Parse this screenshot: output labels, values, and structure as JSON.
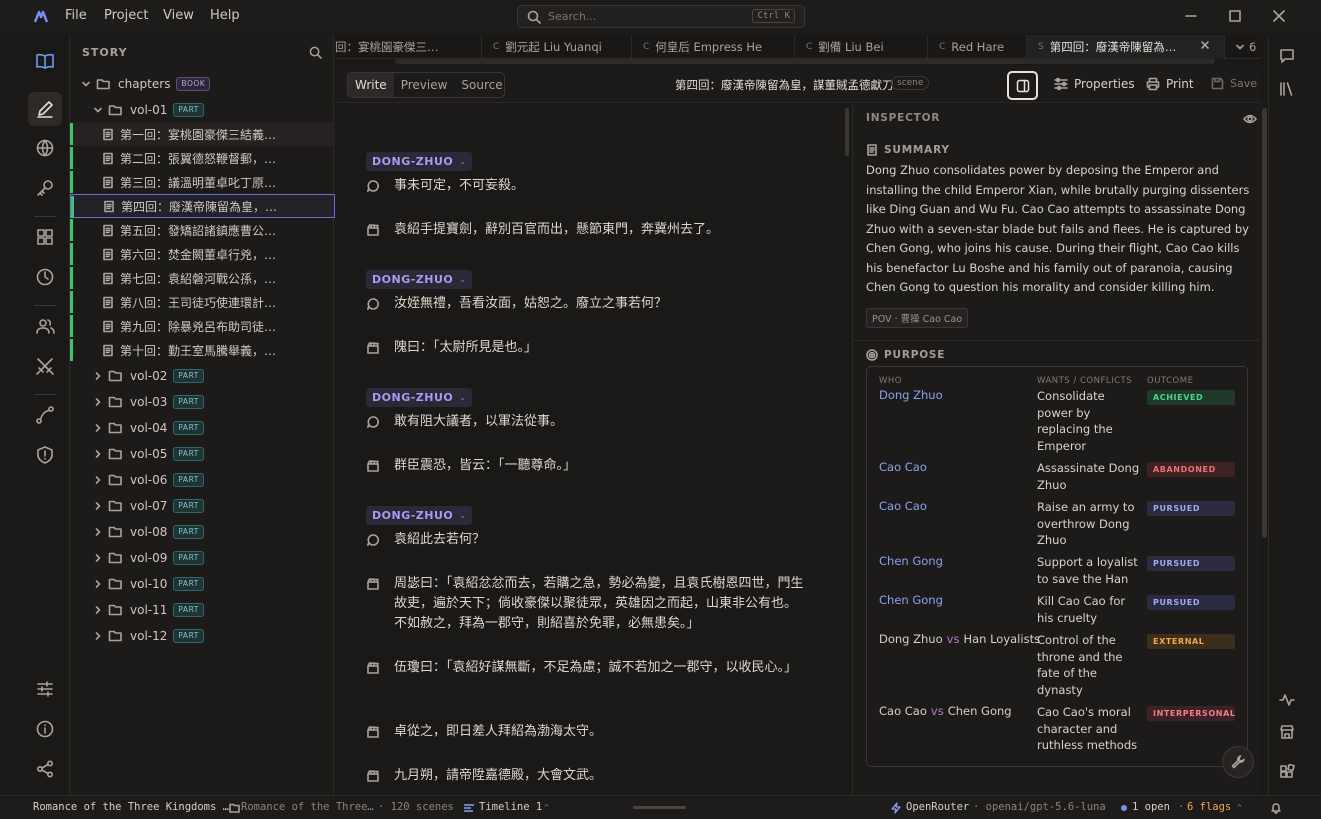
{
  "menu": [
    "File",
    "Project",
    "View",
    "Help"
  ],
  "search": {
    "placeholder": "Search...",
    "shortcut": "Ctrl K"
  },
  "sidebar": {
    "title": "STORY",
    "root": {
      "label": "chapters",
      "badge": "BOOK"
    },
    "vol01": {
      "label": "vol-01",
      "badge": "PART"
    },
    "chapters": [
      "第一回：宴桃園豪傑三結義…",
      "第二回：張翼德怒鞭督郵，…",
      "第三回：議溫明董卓叱丁原…",
      "第四回：廢漢帝陳留為皇，…",
      "第五回：發矯詔諸鎮應曹公…",
      "第六回：焚金闕董卓行兇，…",
      "第七回：袁紹磐河戰公孫，…",
      "第八回：王司徒巧使連環計…",
      "第九回：除暴兇呂布助司徒…",
      "第十回：勤王室馬騰舉義，…"
    ],
    "volumes": [
      "vol-02",
      "vol-03",
      "vol-04",
      "vol-05",
      "vol-06",
      "vol-07",
      "vol-08",
      "vol-09",
      "vol-10",
      "vol-11",
      "vol-12"
    ],
    "part_badge": "PART"
  },
  "tabs": [
    {
      "kind": "",
      "label": "回：宴桃園豪傑三…"
    },
    {
      "kind": "C",
      "label": "劉元起 Liu Yuanqi"
    },
    {
      "kind": "C",
      "label": "何皇后 Empress He"
    },
    {
      "kind": "C",
      "label": "劉備 Liu Bei"
    },
    {
      "kind": "C",
      "label": "Red Hare"
    },
    {
      "kind": "S",
      "label": "第四回：廢漢帝陳留為…"
    }
  ],
  "tab_overflow": "6",
  "toolbar": {
    "modes": [
      "Write",
      "Preview",
      "Source"
    ],
    "doc_title": "第四回：廢漢帝陳留為皇，謀董賊孟德獻刀",
    "doc_kind": "scene",
    "properties": "Properties",
    "print": "Print",
    "save": "Save"
  },
  "editor": {
    "blocks": [
      {
        "type": "speaker",
        "text": "DONG-ZHUO"
      },
      {
        "type": "dialogue",
        "text": "事未可定，不可妄殺。"
      },
      {
        "type": "action",
        "text": "袁紹手提寶劍，辭別百官而出，懸節東門，奔冀州去了。"
      },
      {
        "type": "speaker",
        "text": "DONG-ZHUO"
      },
      {
        "type": "dialogue",
        "text": "汝姪無禮，吾看汝面，姑恕之。廢立之事若何？"
      },
      {
        "type": "action",
        "text": "隗曰：「太尉所見是也。」"
      },
      {
        "type": "speaker",
        "text": "DONG-ZHUO"
      },
      {
        "type": "dialogue",
        "text": "敢有阻大議者，以軍法從事。"
      },
      {
        "type": "action",
        "text": "群臣震恐，皆云：「一聽尊命。」"
      },
      {
        "type": "speaker",
        "text": "DONG-ZHUO"
      },
      {
        "type": "dialogue",
        "text": "袁紹此去若何？"
      },
      {
        "type": "action",
        "text": "周毖曰：「袁紹忿忿而去，若購之急，勢必為變，且袁氏樹恩四世，門生故吏，遍於天下；倘收豪傑以聚徒眾，英雄因之而起，山東非公有也。不如赦之，拜為一郡守，則紹喜於免罪，必無患矣。」"
      },
      {
        "type": "action",
        "text": "伍瓊曰：「袁紹好謀無斷，不足為慮；誠不若加之一郡守，以收民心。」"
      },
      {
        "type": "action",
        "text": "卓從之，即日差人拜紹為渤海太守。"
      },
      {
        "type": "action",
        "text": "九月朔，請帝陞嘉德殿，大會文武。"
      }
    ]
  },
  "inspector": {
    "title": "INSPECTOR",
    "summary_title": "SUMMARY",
    "summary": "Dong Zhuo consolidates power by deposing the Emperor and installing the child Emperor Xian, while brutally purging dissenters like Ding Guan and Wu Fu. Cao Cao attempts to assassinate Dong Zhuo with a seven-star blade but fails and flees. He is captured by Chen Gong, who joins his cause. During their flight, Cao Cao kills his benefactor Lu Boshe and his family out of paranoia, causing Chen Gong to question his morality and consider killing him.",
    "pov": "POV · 曹操 Cao Cao",
    "purpose_title": "PURPOSE",
    "headers": {
      "who": "WHO",
      "wants": "WANTS / CONFLICTS",
      "outcome": "OUTCOME"
    },
    "rows": [
      {
        "who": "Dong Zhuo",
        "who2": "",
        "wants": "Consolidate power by replacing the Emperor",
        "outcome": "ACHIEVED",
        "kind": "achieved"
      },
      {
        "who": "Cao Cao",
        "who2": "",
        "wants": "Assassinate Dong Zhuo",
        "outcome": "ABANDONED",
        "kind": "abandoned"
      },
      {
        "who": "Cao Cao",
        "who2": "",
        "wants": "Raise an army to overthrow Dong Zhuo",
        "outcome": "PURSUED",
        "kind": "pursued"
      },
      {
        "who": "Chen Gong",
        "who2": "",
        "wants": "Support a loyalist to save the Han",
        "outcome": "PURSUED",
        "kind": "pursued"
      },
      {
        "who": "Chen Gong",
        "who2": "",
        "wants": "Kill Cao Cao for his cruelty",
        "outcome": "PURSUED",
        "kind": "pursued"
      },
      {
        "who": "Dong Zhuo",
        "who2": "Han Loyalists",
        "wants": "Control of the throne and the fate of the dynasty",
        "outcome": "EXTERNAL",
        "kind": "external"
      },
      {
        "who": "Cao Cao",
        "who2": "Chen Gong",
        "wants": "Cao Cao's moral character and ruthless methods",
        "outcome": "INTERPERSONAL",
        "kind": "interp"
      }
    ],
    "vs": "vs"
  },
  "status": {
    "project": "Romance of the Three Kingdoms …",
    "path": "Romance of the Three…",
    "scenes": "· 120 scenes",
    "timeline": "Timeline 1",
    "provider": "OpenRouter",
    "model": "· openai/gpt-5.6-luna",
    "open": "1 open",
    "flags": "6 flags"
  },
  "colors": {
    "accent": "#6b6ed8",
    "green": "#3ec46d",
    "speaker": "#a69cf0"
  }
}
